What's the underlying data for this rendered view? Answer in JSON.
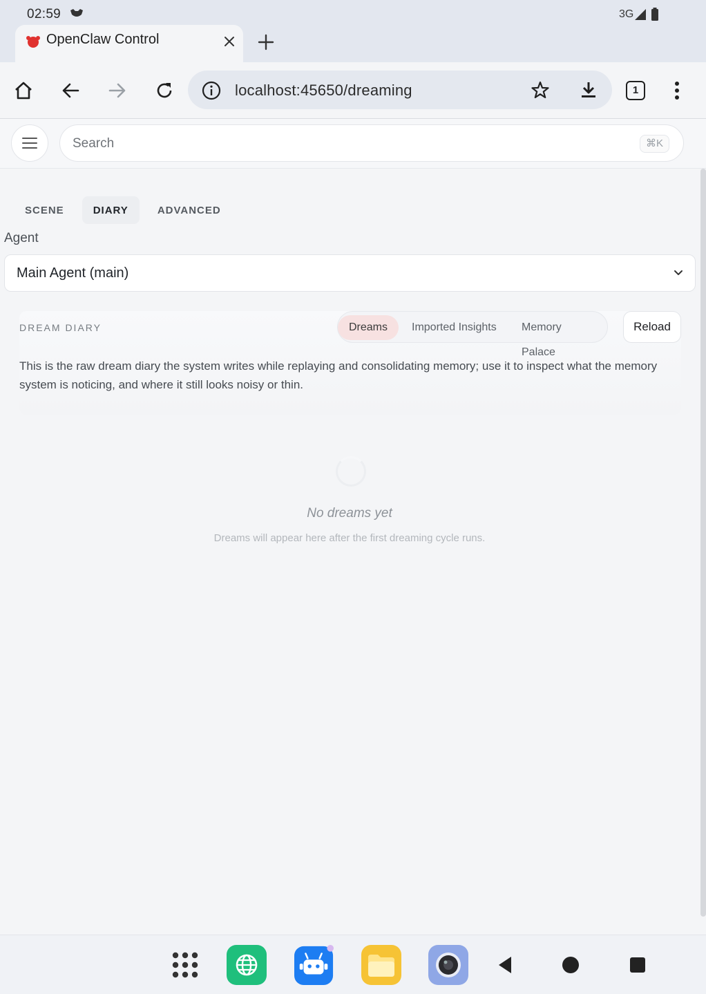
{
  "status_bar": {
    "time": "02:59",
    "network": "3G"
  },
  "browser": {
    "tab_title": "OpenClaw Control",
    "url": "localhost:45650/dreaming",
    "tab_count": "1"
  },
  "app_header": {
    "search_placeholder": "Search",
    "shortcut_hint": "⌘K"
  },
  "mode_tabs": [
    {
      "label": "SCENE",
      "active": false
    },
    {
      "label": "DIARY",
      "active": true
    },
    {
      "label": "ADVANCED",
      "active": false
    }
  ],
  "agent": {
    "label": "Agent",
    "selected": "Main Agent (main)"
  },
  "diary": {
    "title": "DREAM DIARY",
    "subtabs": [
      {
        "label": "Dreams",
        "active": true
      },
      {
        "label": "Imported Insights",
        "active": false
      },
      {
        "label": "Memory Palace",
        "active": false
      }
    ],
    "reload_label": "Reload",
    "description": "This is the raw dream diary the system writes while replaying and consolidating memory; use it to inspect what the memory system is noticing, and where it still looks noisy or thin."
  },
  "empty_state": {
    "title": "No dreams yet",
    "subtitle": "Dreams will appear here after the first dreaming cycle runs."
  },
  "colors": {
    "accent_tab": "#f7e1e1",
    "favicon": "#e0322f",
    "browser_chrome": "#e3e7ef"
  },
  "dock_icons": [
    "app-drawer-icon",
    "browser-icon",
    "robot-app-icon",
    "files-icon",
    "camera-icon",
    "back-icon",
    "home-icon",
    "recents-icon"
  ]
}
